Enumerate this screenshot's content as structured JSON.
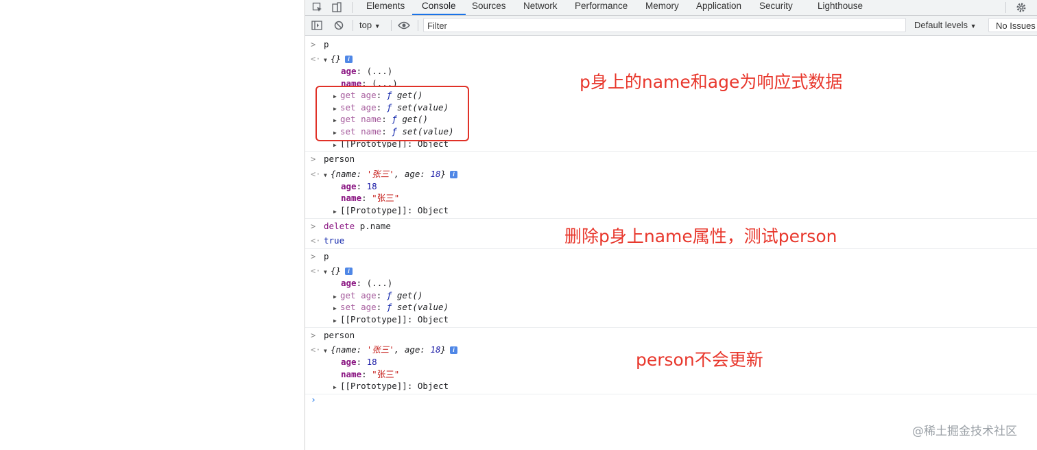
{
  "tabs": [
    "Elements",
    "Console",
    "Sources",
    "Network",
    "Performance",
    "Memory",
    "Application",
    "Security",
    "Lighthouse"
  ],
  "active_tab": "Console",
  "toolbar": {
    "context": "top",
    "filter_placeholder": "Filter",
    "levels": "Default levels",
    "issues": "No Issues"
  },
  "console": {
    "p1_input": "p",
    "p1_obj": "{}",
    "p1_age": "age",
    "p1_age_val": "(...)",
    "p1_name": "name",
    "p1_name_val": "(...)",
    "getter_age": "get age",
    "setter_age": "set age",
    "getter_name": "get name",
    "setter_name": "set name",
    "fn_get": "get()",
    "fn_set": "set(value)",
    "f_sym": "ƒ",
    "proto": "[[Prototype]]",
    "proto_val": "Object",
    "person_input": "person",
    "person_name_key": "name",
    "person_name_str": "'张三'",
    "person_age_key": "age",
    "person_age_num": "18",
    "person_age": "age",
    "person_age_val": "18",
    "person_name": "name",
    "person_name_val": "\"张三\"",
    "delete_kw": "delete",
    "delete_expr": "p.name",
    "delete_result": "true",
    "p2_input": "p"
  },
  "annotations": {
    "a1": "p身上的name和age为响应式数据",
    "a2": "删除p身上name属性，测试person",
    "a3": "person不会更新"
  },
  "watermark": "@稀土掘金技术社区"
}
